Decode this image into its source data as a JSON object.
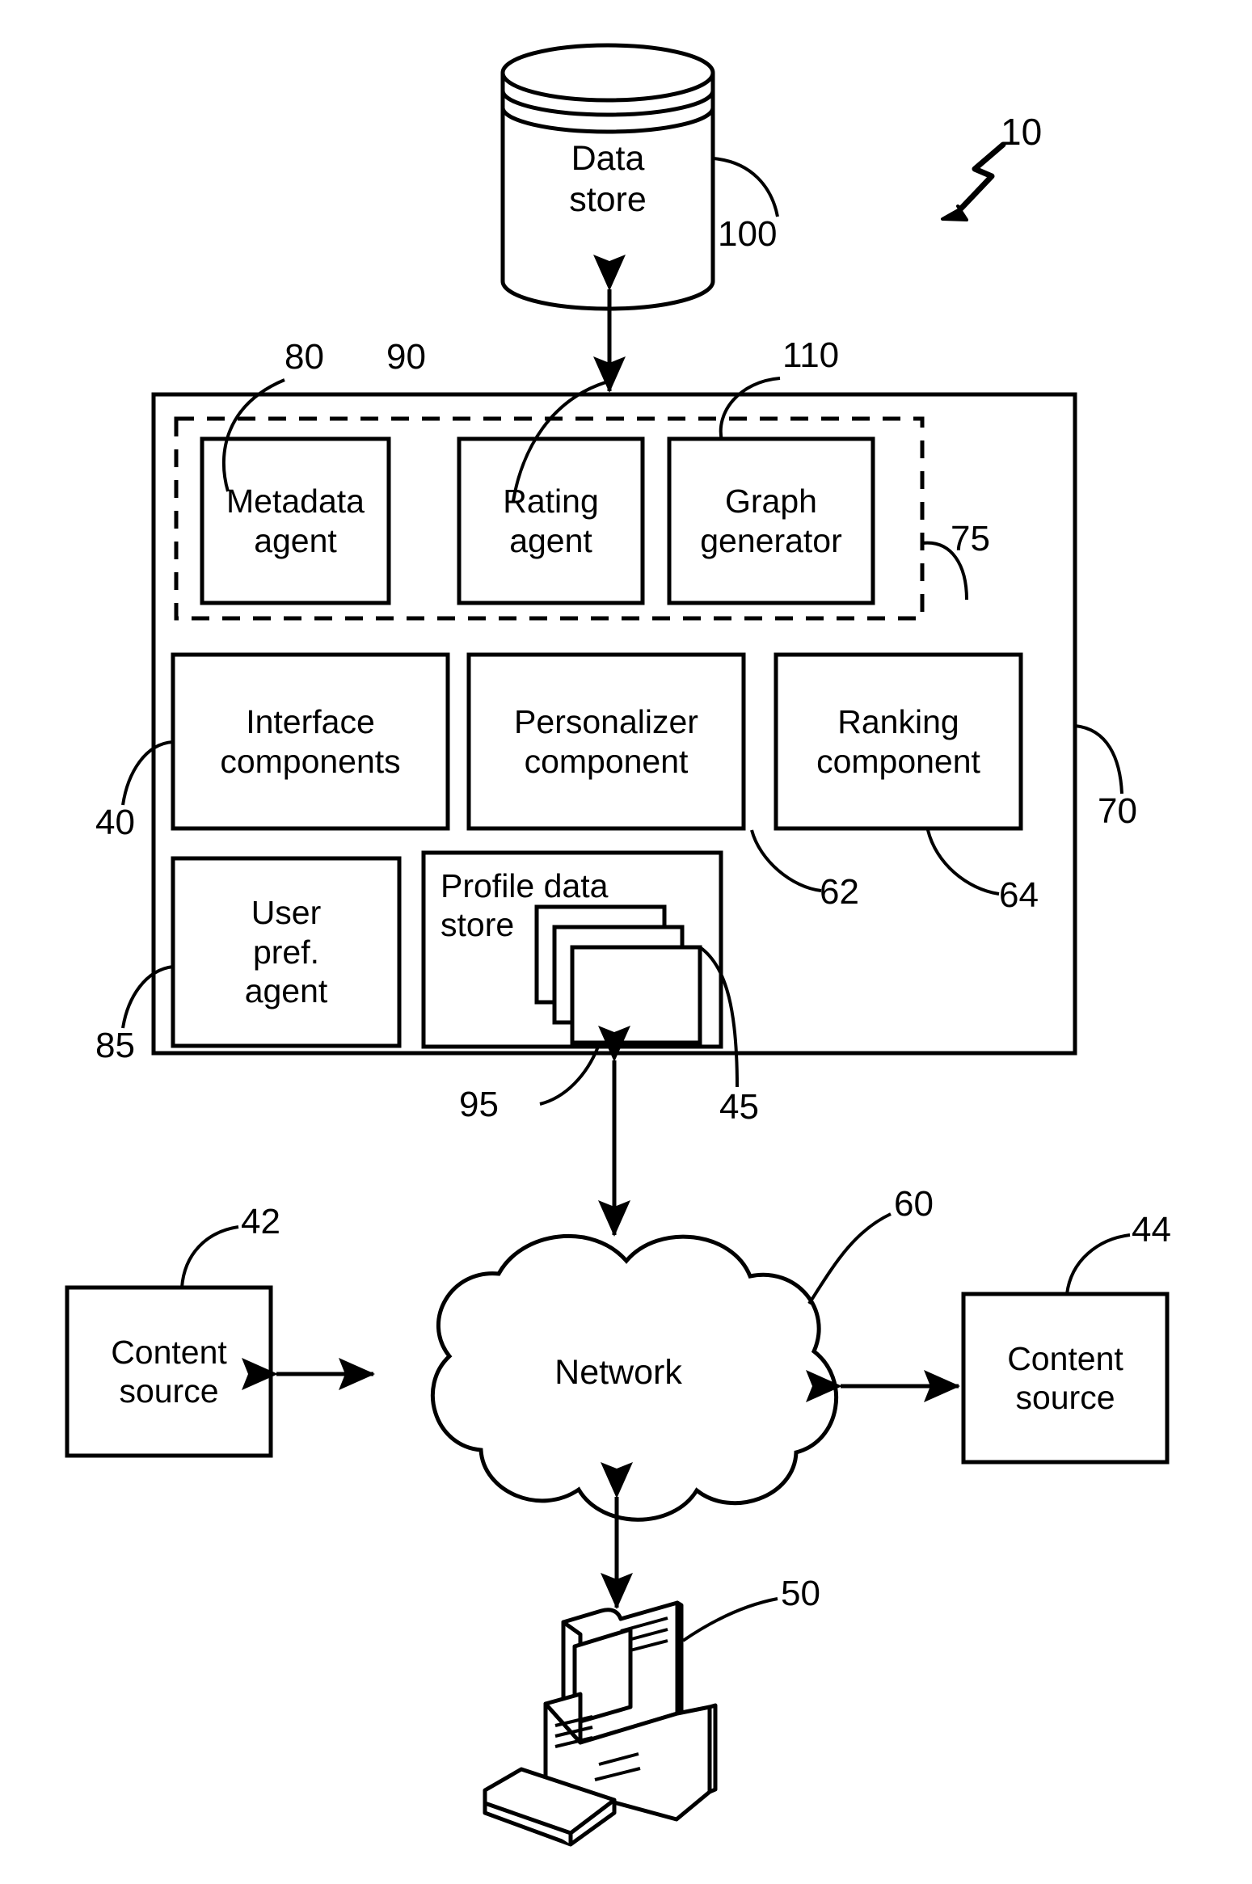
{
  "figure": {
    "figure_ref": "10",
    "type": "patent-block-diagram"
  },
  "datastore": {
    "label": "Data\nstore",
    "ref": "100"
  },
  "system": {
    "ref_left": "40",
    "ref_right": "70",
    "dashed_group_ref": "75",
    "agents": [
      {
        "label": "Metadata\nagent",
        "ref": "80"
      },
      {
        "label": "Rating\nagent",
        "ref": "90"
      },
      {
        "label": "Graph\ngenerator",
        "ref": "110"
      }
    ],
    "components": [
      {
        "label": "Interface\ncomponents",
        "ref": ""
      },
      {
        "label": "Personalizer\ncomponent",
        "ref": "62"
      },
      {
        "label": "Ranking\ncomponent",
        "ref": "64"
      }
    ],
    "user_pref_agent": {
      "label": "User\npref.\nagent",
      "ref": "85"
    },
    "profile_store": {
      "label": "Profile data\nstore",
      "ref": "95"
    },
    "system_ref": "45"
  },
  "network": {
    "label": "Network",
    "ref": "60"
  },
  "content_sources": [
    {
      "label": "Content\nsource",
      "ref": "42"
    },
    {
      "label": "Content\nsource",
      "ref": "44"
    }
  ],
  "client": {
    "ref": "50",
    "icon": "desktop-computer-icon"
  },
  "colors": {
    "ink": "#000000",
    "paper": "#ffffff"
  }
}
